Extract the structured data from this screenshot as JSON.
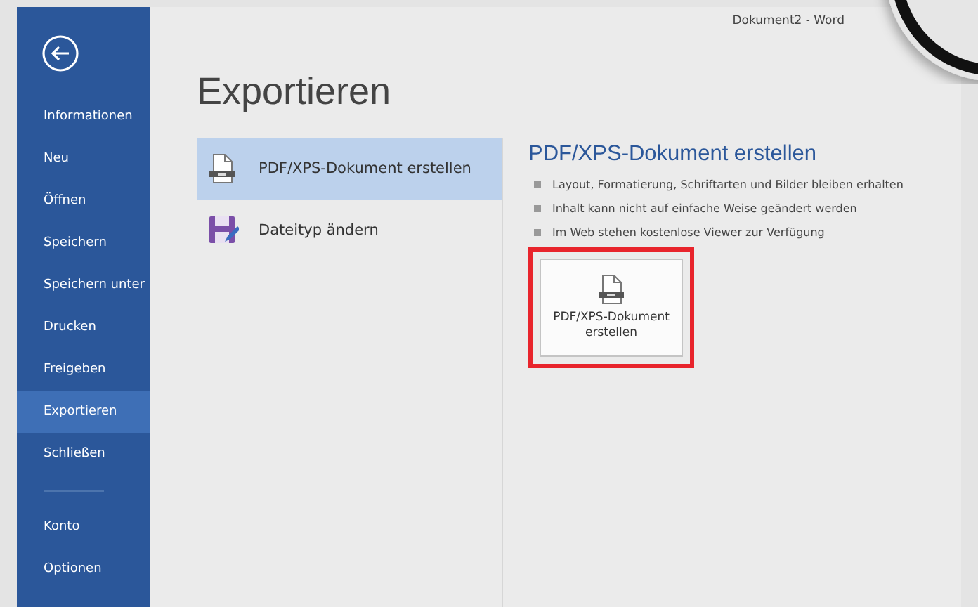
{
  "window": {
    "title": "Dokument2 - Word"
  },
  "sidebar": {
    "items": [
      {
        "kind": "item",
        "label": "Informationen",
        "selected": false
      },
      {
        "kind": "item",
        "label": "Neu",
        "selected": false
      },
      {
        "kind": "item",
        "label": "Öffnen",
        "selected": false
      },
      {
        "kind": "item",
        "label": "Speichern",
        "selected": false
      },
      {
        "kind": "item",
        "label": "Speichern unter",
        "selected": false
      },
      {
        "kind": "item",
        "label": "Drucken",
        "selected": false
      },
      {
        "kind": "item",
        "label": "Freigeben",
        "selected": false
      },
      {
        "kind": "item",
        "label": "Exportieren",
        "selected": true
      },
      {
        "kind": "item",
        "label": "Schließen",
        "selected": false
      },
      {
        "kind": "separator"
      },
      {
        "kind": "item",
        "label": "Konto",
        "selected": false
      },
      {
        "kind": "item",
        "label": "Optionen",
        "selected": false
      }
    ]
  },
  "page_title": "Exportieren",
  "options": [
    {
      "kind": "pdf",
      "label": "PDF/XPS-Dokument erstellen",
      "selected": true
    },
    {
      "kind": "filetype",
      "label": "Dateityp ändern",
      "selected": false
    }
  ],
  "detail": {
    "heading": "PDF/XPS-Dokument erstellen",
    "bullets": [
      "Layout, Formatierung, Schriftarten und Bilder bleiben erhalten",
      "Inhalt kann nicht auf einfache Weise geändert werden",
      "Im Web stehen kostenlose Viewer zur Verfügung"
    ],
    "button": {
      "label": "PDF/XPS-Dokument erstellen",
      "highlighted": true
    }
  }
}
